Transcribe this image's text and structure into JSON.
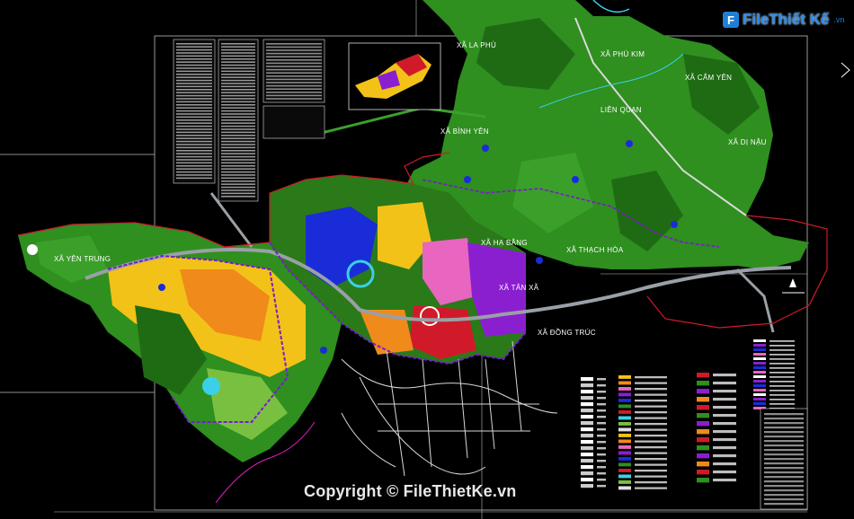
{
  "logo": {
    "brand": "FileThiết Kế",
    "suffix": ".vn"
  },
  "watermark": "Copyright © FileThietKe.vn",
  "places": {
    "yen_trung": "XÃ YÊN TRUNG",
    "la_phu": "XÃ LA PHÙ",
    "phu_kim": "XÃ PHÚ KIM",
    "cam_yen": "XÃ CẨM YÊN",
    "di_nau": "XÃ DỊ NẬU",
    "binh_yen": "XÃ BÌNH YÊN",
    "ha_bang": "XÃ HẠ BẰNG",
    "tan_xa": "XÃ TÂN XÃ",
    "thach_hoa": "XÃ THẠCH HÒA",
    "dong_truc": "XÃ ĐỒNG TRÚC",
    "lien_quan": "LIÊN QUAN"
  },
  "colors": {
    "background": "#000000",
    "rural_green": "#2f8f1f",
    "forest": "#1f6b14",
    "urban_yellow": "#f2c218",
    "residential_orange": "#f08a1a",
    "institutional_blue": "#1a2cd8",
    "industrial_purple": "#8a1fd0",
    "pink_zone": "#e866c0",
    "road_gray": "#9aa0a6",
    "boundary_red": "#d01a2a",
    "boundary_purple": "#7a1ad0",
    "water": "#3ad0e8"
  }
}
